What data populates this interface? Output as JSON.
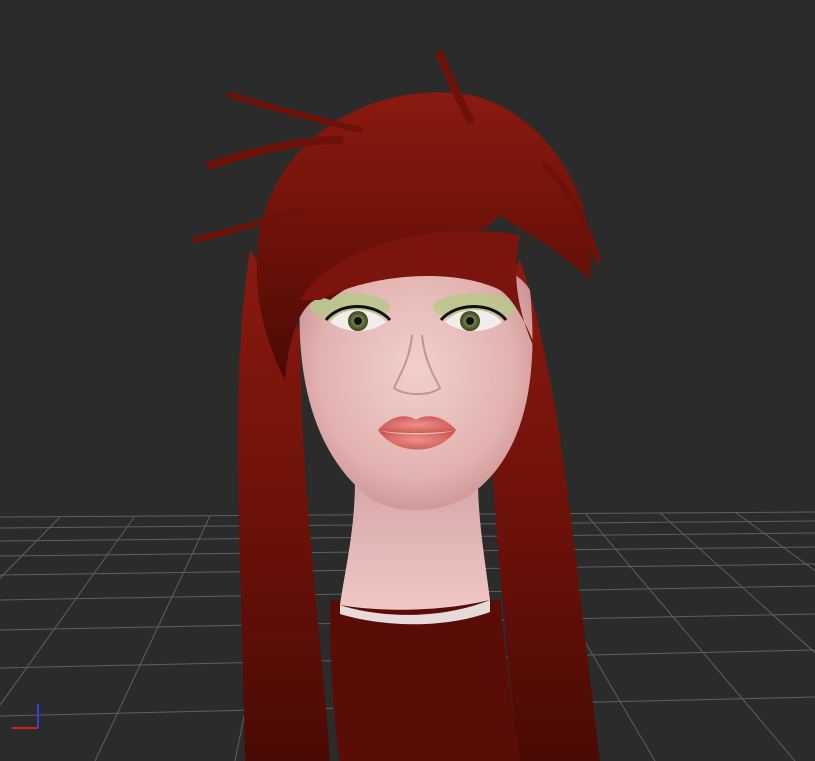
{
  "viewport": {
    "background_color": "#2b2b2b",
    "grid_color": "#8a8a8a",
    "mode": "3d-perspective"
  },
  "scene": {
    "model": "female-head-bust",
    "hair_color": "#7a140c",
    "skin_color": "#e3b8b6",
    "lip_color": "#e0706a",
    "eyeshadow_color": "#b4c98a",
    "iris_color": "#7c8a4a"
  },
  "axis_gizmo": {
    "x_color": "#d62020",
    "y_color": "#20c020",
    "z_color": "#3040e0"
  }
}
